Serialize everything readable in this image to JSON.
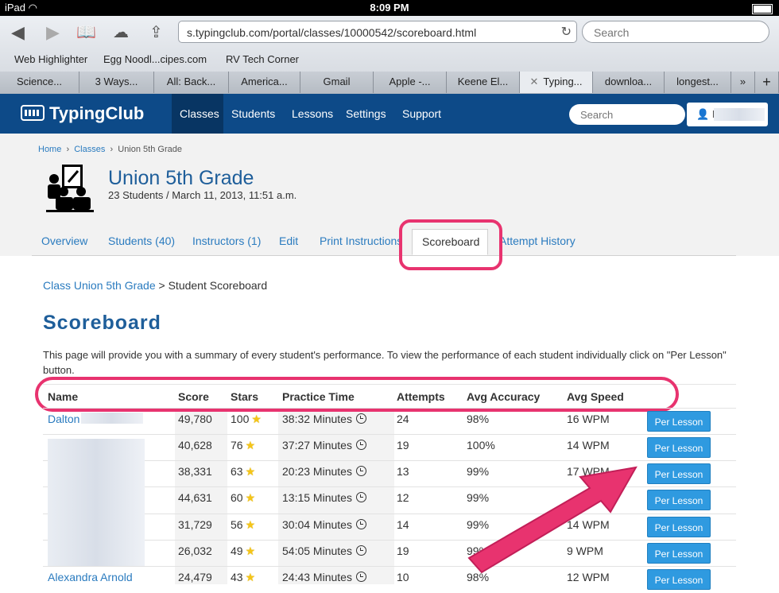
{
  "status": {
    "device": "iPad",
    "time": "8:09 PM"
  },
  "browser": {
    "url": "s.typingclub.com/portal/classes/10000542/scoreboard.html",
    "search_placeholder": "Search",
    "bookmarks": [
      "Web Highlighter",
      "Egg Noodl...cipes.com",
      "RV Tech Corner"
    ],
    "tabs": [
      "Science...",
      "3 Ways...",
      "All: Back...",
      "America...",
      "Gmail",
      "Apple -...",
      "Keene El...",
      "Typing...",
      "downloa...",
      "longest..."
    ],
    "tab_more": "»",
    "new_tab": "+"
  },
  "app": {
    "logo": "TypingClub",
    "nav": [
      "Classes",
      "Students",
      "Lessons",
      "Settings",
      "Support"
    ],
    "search_placeholder": "Search",
    "user_initial": "D"
  },
  "breadcrumb": {
    "home": "Home",
    "classes": "Classes",
    "current": "Union 5th Grade"
  },
  "class": {
    "title": "Union 5th Grade",
    "subtitle": "23 Students / March 11, 2013, 11:51 a.m."
  },
  "subtabs": [
    "Overview",
    "Students (40)",
    "Instructors (1)",
    "Edit",
    "Print Instructions",
    "Scoreboard",
    "Attempt History"
  ],
  "scoreboard": {
    "crumb_link": "Class Union 5th Grade",
    "crumb_rest": " > Student Scoreboard",
    "heading": "Scoreboard",
    "description": "This page will provide you with a summary of every student's performance. To view the performance of each student individually click on \"Per Lesson\" button.",
    "columns": [
      "Name",
      "Score",
      "Stars",
      "Practice Time",
      "Attempts",
      "Avg Accuracy",
      "Avg Speed"
    ],
    "button_label": "Per Lesson",
    "rows": [
      {
        "name": "Dalton",
        "score": "49,780",
        "stars": "100",
        "time": "38:32 Minutes",
        "attempts": "24",
        "accuracy": "98%",
        "speed": "16 WPM"
      },
      {
        "name": "",
        "score": "40,628",
        "stars": "76",
        "time": "37:27 Minutes",
        "attempts": "19",
        "accuracy": "100%",
        "speed": "14 WPM"
      },
      {
        "name": "",
        "score": "38,331",
        "stars": "63",
        "time": "20:23 Minutes",
        "attempts": "13",
        "accuracy": "99%",
        "speed": "17 WPM"
      },
      {
        "name": "",
        "score": "44,631",
        "stars": "60",
        "time": "13:15 Minutes",
        "attempts": "12",
        "accuracy": "99%",
        "speed": ""
      },
      {
        "name": "",
        "score": "31,729",
        "stars": "56",
        "time": "30:04 Minutes",
        "attempts": "14",
        "accuracy": "99%",
        "speed": "14 WPM"
      },
      {
        "name": "",
        "score": "26,032",
        "stars": "49",
        "time": "54:05 Minutes",
        "attempts": "19",
        "accuracy": "99%",
        "speed": "9 WPM"
      },
      {
        "name": "Alexandra Arnold",
        "score": "24,479",
        "stars": "43",
        "time": "24:43 Minutes",
        "attempts": "10",
        "accuracy": "98%",
        "speed": "12 WPM"
      }
    ]
  },
  "colors": {
    "header": "#0d4a88",
    "highlight": "#e8336f",
    "link": "#2a7bbf",
    "button": "#2f9ae0"
  }
}
